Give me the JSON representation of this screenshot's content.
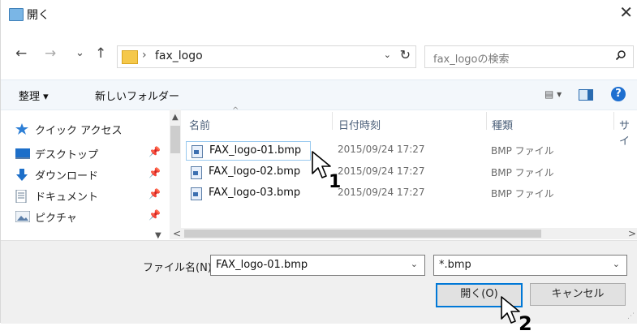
{
  "window": {
    "title": "開く",
    "close_glyph": "✕"
  },
  "nav": {
    "back": "←",
    "forward": "→",
    "recent": "⌄",
    "up": "↑"
  },
  "address": {
    "separator": "›",
    "path": "fax_logo",
    "dropdown": "⌄",
    "refresh": "↻"
  },
  "search": {
    "placeholder": "fax_logoの検索",
    "icon": "search-icon"
  },
  "toolbar": {
    "organize": "整理 ▾",
    "new_folder": "新しいフォルダー",
    "view_glyph": "▤ ▾",
    "help": "?"
  },
  "sidebar": {
    "items": [
      {
        "label": "クイック アクセス",
        "icon": "star-icon",
        "pinned": false
      },
      {
        "label": "デスクトップ",
        "icon": "desktop-icon",
        "pinned": true
      },
      {
        "label": "ダウンロード",
        "icon": "download-icon",
        "pinned": true
      },
      {
        "label": "ドキュメント",
        "icon": "document-icon",
        "pinned": true
      },
      {
        "label": "ピクチャ",
        "icon": "picture-icon",
        "pinned": true
      }
    ],
    "pin_glyph": "✦"
  },
  "columns": {
    "name": "名前",
    "date": "日付時刻",
    "type": "種類",
    "size": "サイ"
  },
  "files": [
    {
      "name": "FAX_logo-01.bmp",
      "date": "2015/09/24 17:27",
      "type": "BMP ファイル"
    },
    {
      "name": "FAX_logo-02.bmp",
      "date": "2015/09/24 17:27",
      "type": "BMP ファイル"
    },
    {
      "name": "FAX_logo-03.bmp",
      "date": "2015/09/24 17:27",
      "type": "BMP ファイル"
    }
  ],
  "scroll": {
    "up": "▲",
    "down": "▼",
    "left": "<",
    "right": ">"
  },
  "bottom": {
    "filename_label": "ファイル名(N):",
    "filename_value": "FAX_logo-01.bmp",
    "filetype_value": "*.bmp",
    "open_button": "開く(O)",
    "cancel_button": "キャンセル"
  },
  "callouts": {
    "one": "1",
    "two": "2"
  },
  "colors": {
    "accent": "#0078d7",
    "link_blue": "#1e6fd0",
    "toolbar_bg": "#f3f7fb"
  }
}
